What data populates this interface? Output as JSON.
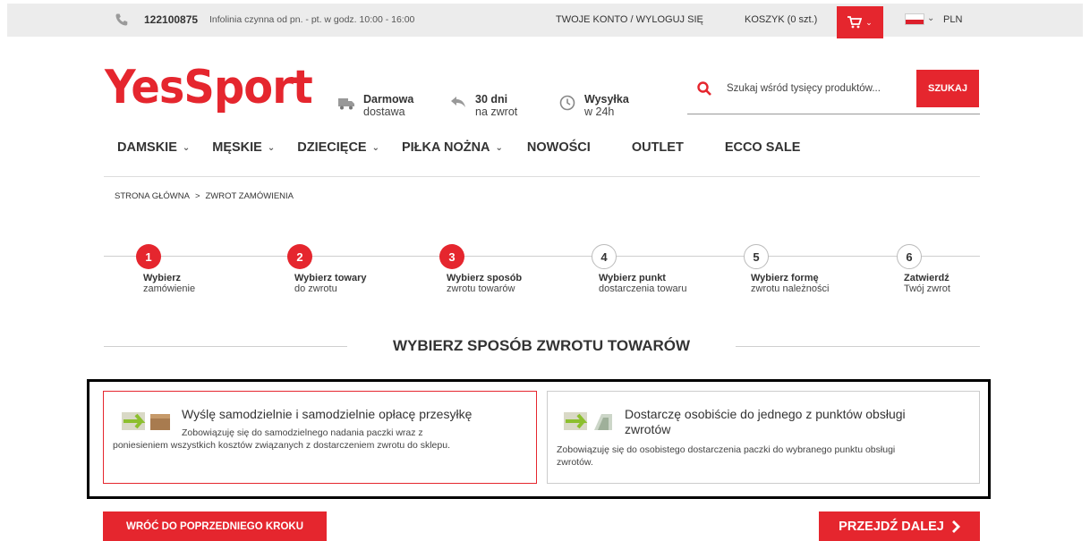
{
  "topbar": {
    "phone": "122100875",
    "hours": "Infolinia czynna od pn. - pt. w godz. 10:00 - 16:00",
    "account": "TWOJE KONTO",
    "separator": "/",
    "logout": "WYLOGUJ SIĘ",
    "cart": "KOSZYK (0 szt.)",
    "currency": "PLN"
  },
  "header": {
    "logo": "YesSport",
    "features": [
      {
        "icon": "truck-icon",
        "line1": "Darmowa",
        "line2": "dostawa"
      },
      {
        "icon": "return-arrow-icon",
        "line1": "30 dni",
        "line2": "na zwrot"
      },
      {
        "icon": "clock-icon",
        "line1": "Wysyłka",
        "line2": "w 24h"
      }
    ],
    "search": {
      "placeholder": "Szukaj wśród tysięcy produktów...",
      "button": "SZUKAJ"
    }
  },
  "nav": [
    {
      "label": "DAMSKIE",
      "dropdown": true
    },
    {
      "label": "MĘSKIE",
      "dropdown": true
    },
    {
      "label": "DZIECIĘCE",
      "dropdown": true
    },
    {
      "label": "PIŁKA NOŻNA",
      "dropdown": true
    },
    {
      "label": "NOWOŚCI",
      "dropdown": false
    },
    {
      "label": "OUTLET",
      "dropdown": false
    },
    {
      "label": "ECCO SALE",
      "dropdown": false
    }
  ],
  "breadcrumb": {
    "home": "STRONA GŁÓWNA",
    "sep": ">",
    "current": "ZWROT ZAMÓWIENIA"
  },
  "steps": [
    {
      "num": "1",
      "line1": "Wybierz",
      "line2": "zamówienie",
      "active": true
    },
    {
      "num": "2",
      "line1": "Wybierz towary",
      "line2": "do zwrotu",
      "active": true
    },
    {
      "num": "3",
      "line1": "Wybierz sposób",
      "line2": "zwrotu towarów",
      "active": true
    },
    {
      "num": "4",
      "line1": "Wybierz punkt",
      "line2": "dostarczenia towaru",
      "active": false
    },
    {
      "num": "5",
      "line1": "Wybierz formę",
      "line2": "zwrotu należności",
      "active": false
    },
    {
      "num": "6",
      "line1": "Zatwierdź",
      "line2": "Twój zwrot",
      "active": false
    }
  ],
  "section_title": "WYBIERZ SPOSÓB ZWROTU TOWARÓW",
  "options": [
    {
      "title": "Wyślę samodzielnie i samodzielnie opłacę przesyłkę",
      "desc_line1": "Zobowiązuję się do samodzielnego nadania paczki wraz z",
      "desc_line2": "poniesieniem wszystkich kosztów związanych z dostarczeniem zwrotu do sklepu.",
      "selected": true
    },
    {
      "title_line1": "Dostarczę osobiście do jednego z punktów obsługi",
      "title_line2": "zwrotów",
      "desc_line1": "Zobowiązuję się do osobistego dostarczenia paczki do wybranego punktu obsługi",
      "desc_line2": "zwrotów.",
      "selected": false
    }
  ],
  "buttons": {
    "back": "WRÓĆ DO POPRZEDNIEGO KROKU",
    "next": "PRZEJDŹ DALEJ"
  },
  "colors": {
    "accent": "#e5262e",
    "topbar_bg": "#ececec"
  }
}
